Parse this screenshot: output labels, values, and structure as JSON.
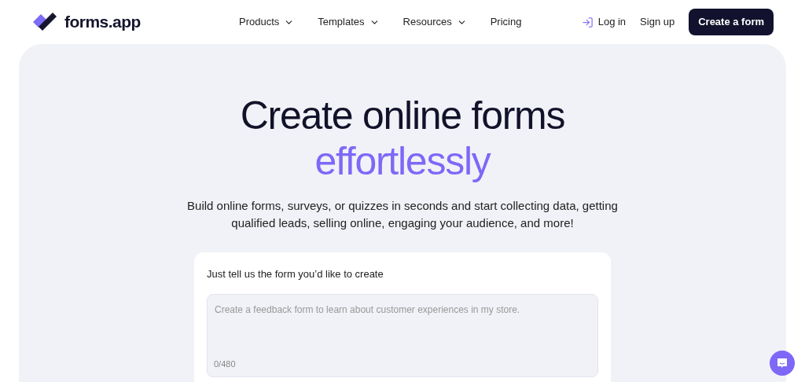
{
  "brand": {
    "name": "forms.app"
  },
  "nav": [
    {
      "label": "Products",
      "dropdown": true
    },
    {
      "label": "Templates",
      "dropdown": true
    },
    {
      "label": "Resources",
      "dropdown": true
    },
    {
      "label": "Pricing",
      "dropdown": false
    }
  ],
  "auth": {
    "login": "Log in",
    "signup": "Sign up",
    "cta": "Create a form"
  },
  "hero": {
    "title": "Create online forms",
    "highlight": "effortlessly",
    "subtitle": "Build online forms, surveys, or quizzes in seconds and start collecting data, getting qualified leads, selling online, engaging your audience, and more!"
  },
  "prompt_card": {
    "label": "Just tell us the form you’d like to create",
    "placeholder": "Create a feedback form to learn about customer experiences in my store.",
    "counter": "0/480"
  }
}
